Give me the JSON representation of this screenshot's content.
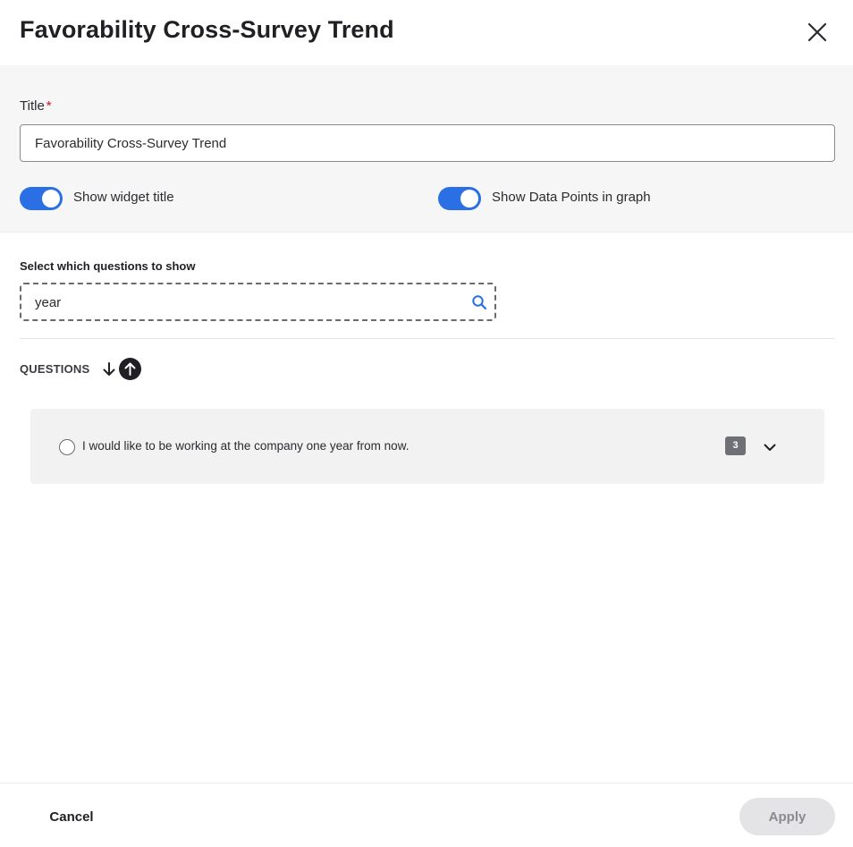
{
  "dialog": {
    "title": "Favorability Cross-Survey Trend"
  },
  "settings": {
    "title_label": "Title",
    "required_mark": "*",
    "title_value": "Favorability Cross-Survey Trend",
    "toggles": [
      {
        "label": "Show widget title",
        "on": true
      },
      {
        "label": "Show Data Points in graph",
        "on": true
      }
    ]
  },
  "question_picker": {
    "label": "Select which questions to show",
    "search_value": "year",
    "header": "QUESTIONS",
    "items": [
      {
        "text": "I would like to be working at the company one year from now.",
        "count": "3",
        "selected": false
      }
    ]
  },
  "footer": {
    "cancel_label": "Cancel",
    "apply_label": "Apply"
  },
  "colors": {
    "accent": "#2a6fe3",
    "required": "#d0102b"
  },
  "icons": [
    "close-icon",
    "search-icon",
    "arrow-down-icon",
    "arrow-up-icon",
    "chevron-down-icon"
  ]
}
